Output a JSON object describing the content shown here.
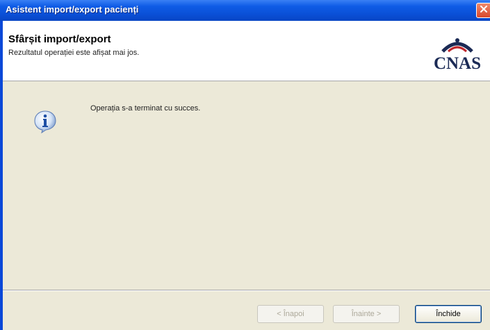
{
  "window": {
    "title": "Asistent import/export pacienți",
    "close_icon": "close-icon"
  },
  "header": {
    "title": "Sfârșit import/export",
    "subtitle": "Rezultatul operației este afișat mai jos.",
    "logo_text": "CNAS"
  },
  "content": {
    "icon": "info-icon",
    "message": "Operația s-a terminat cu succes."
  },
  "buttons": {
    "back": "< Înapoi",
    "next": "Înainte >",
    "close": "Închide"
  },
  "colors": {
    "titlebar": "#0a4fd6",
    "client_bg": "#ece9d8",
    "logo": "#1b2a55",
    "close_btn": "#d8462a"
  }
}
